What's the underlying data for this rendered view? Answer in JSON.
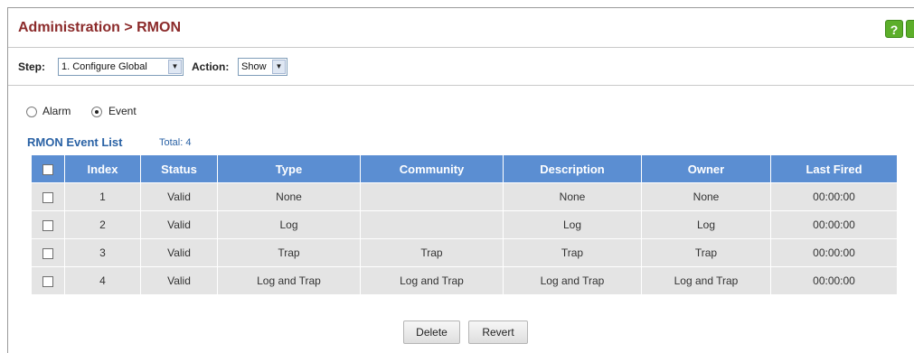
{
  "header": {
    "title": "Administration > RMON"
  },
  "toolbar": {
    "step_label": "Step:",
    "step_value": "1. Configure Global",
    "action_label": "Action:",
    "action_value": "Show"
  },
  "radios": [
    {
      "label": "Alarm",
      "selected": false
    },
    {
      "label": "Event",
      "selected": true
    }
  ],
  "list": {
    "title": "RMON Event List",
    "total": "Total: 4",
    "columns": [
      "Index",
      "Status",
      "Type",
      "Community",
      "Description",
      "Owner",
      "Last Fired"
    ],
    "rows": [
      [
        "1",
        "Valid",
        "None",
        "",
        "None",
        "None",
        "00:00:00"
      ],
      [
        "2",
        "Valid",
        "Log",
        "",
        "Log",
        "Log",
        "00:00:00"
      ],
      [
        "3",
        "Valid",
        "Trap",
        "Trap",
        "Trap",
        "Trap",
        "00:00:00"
      ],
      [
        "4",
        "Valid",
        "Log and Trap",
        "Log and Trap",
        "Log and Trap",
        "Log and Trap",
        "00:00:00"
      ]
    ]
  },
  "buttons": {
    "delete": "Delete",
    "revert": "Revert"
  },
  "icons": {
    "help": "?"
  },
  "colors": {
    "title": "#8b2a2a",
    "header_bg": "#5b8ed2",
    "row_bg": "#e4e4e4",
    "accent_text": "#2a62a5"
  }
}
